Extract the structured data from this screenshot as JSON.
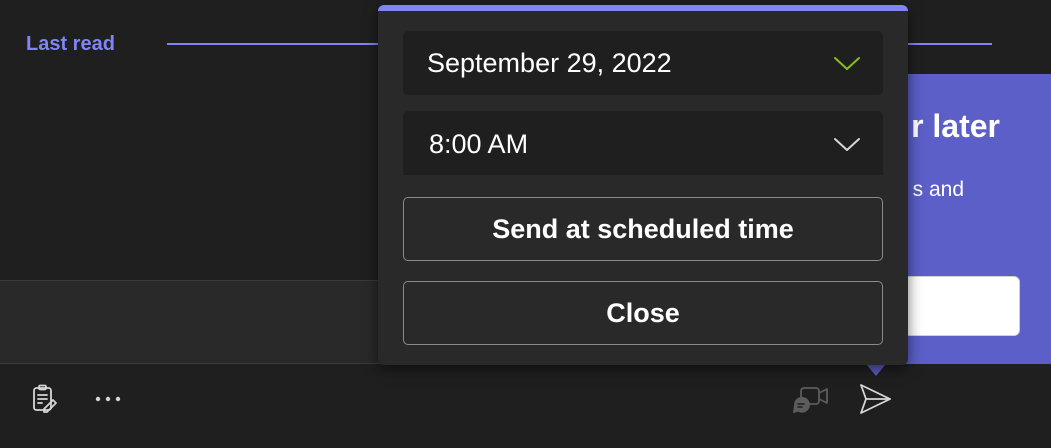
{
  "chat": {
    "last_read_label": "Last read"
  },
  "callout": {
    "title_fragment": "r later",
    "body_fragment": "s and",
    "accent_color": "#5b5fc7"
  },
  "schedule_popup": {
    "accent_color": "#7f85f5",
    "date_value": "September 29, 2022",
    "time_value": "8:00 AM",
    "send_button_label": "Send at scheduled time",
    "close_button_label": "Close"
  },
  "toolbar": {
    "icons": [
      "loop-component-icon",
      "more-options-icon",
      "meet-now-icon",
      "send-icon"
    ]
  }
}
